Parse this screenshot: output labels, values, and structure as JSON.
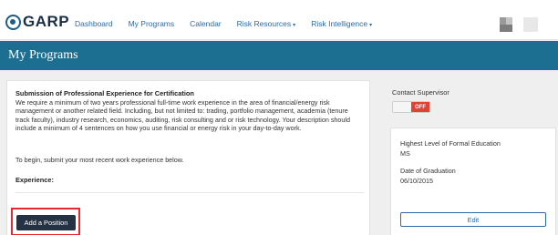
{
  "header": {
    "logo_text": "GARP",
    "nav": [
      {
        "label": "Dashboard",
        "caret": ""
      },
      {
        "label": "My Programs",
        "caret": ""
      },
      {
        "label": "Calendar",
        "caret": ""
      },
      {
        "label": "Risk Resources",
        "caret": "▾"
      },
      {
        "label": "Risk Intelligence",
        "caret": "▾"
      }
    ]
  },
  "page": {
    "title": "My Programs"
  },
  "experience_card": {
    "heading": "Submission of Professional Experience for Certification",
    "body": "We require a minimum of two years professional full-time work experience in the area of financial/energy risk management or another related field. Including, but not limited to: trading, portfolio management, academia (tenure track faculty), industry research, economics, auditing, risk consulting and or risk technology. Your description should include a minimum of 4 sentences on how you use financial or energy risk in your day-to-day work.",
    "begin_text": "To begin, submit your most recent work experience below.",
    "experience_label": "Experience:",
    "add_button": "Add a Position"
  },
  "sidebar": {
    "contact_label": "Contact Supervisor",
    "toggle_state": "OFF",
    "education_label": "Highest Level of Formal Education",
    "education_value": "MS",
    "graduation_label": "Date of Graduation",
    "graduation_value": "06/10/2015",
    "edit_button": "Edit"
  },
  "colors": {
    "title_band": "#1d6f91",
    "nav_link": "#2b6aa6",
    "primary_button": "#253244",
    "toggle_off": "#e34136",
    "highlight": "#e8272f"
  }
}
